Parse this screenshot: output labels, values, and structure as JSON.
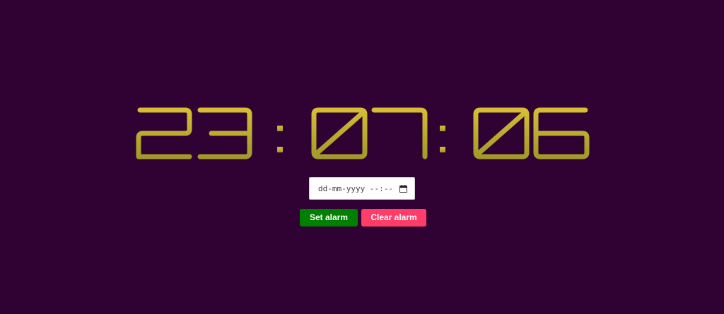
{
  "clock": {
    "hours": "23",
    "minutes": "07",
    "seconds": "06",
    "text": "23 : 07 : 06",
    "gradient_top": "#d6bd34",
    "gradient_bottom": "#a29a2a"
  },
  "alarm_input": {
    "value": "dd-mm-yyyy --:--",
    "icon": "calendar-icon"
  },
  "buttons": {
    "set_label": "Set alarm",
    "set_color": "#008000",
    "clear_label": "Clear alarm",
    "clear_color": "#ff3d68"
  },
  "colors": {
    "background": "#2f0233"
  }
}
